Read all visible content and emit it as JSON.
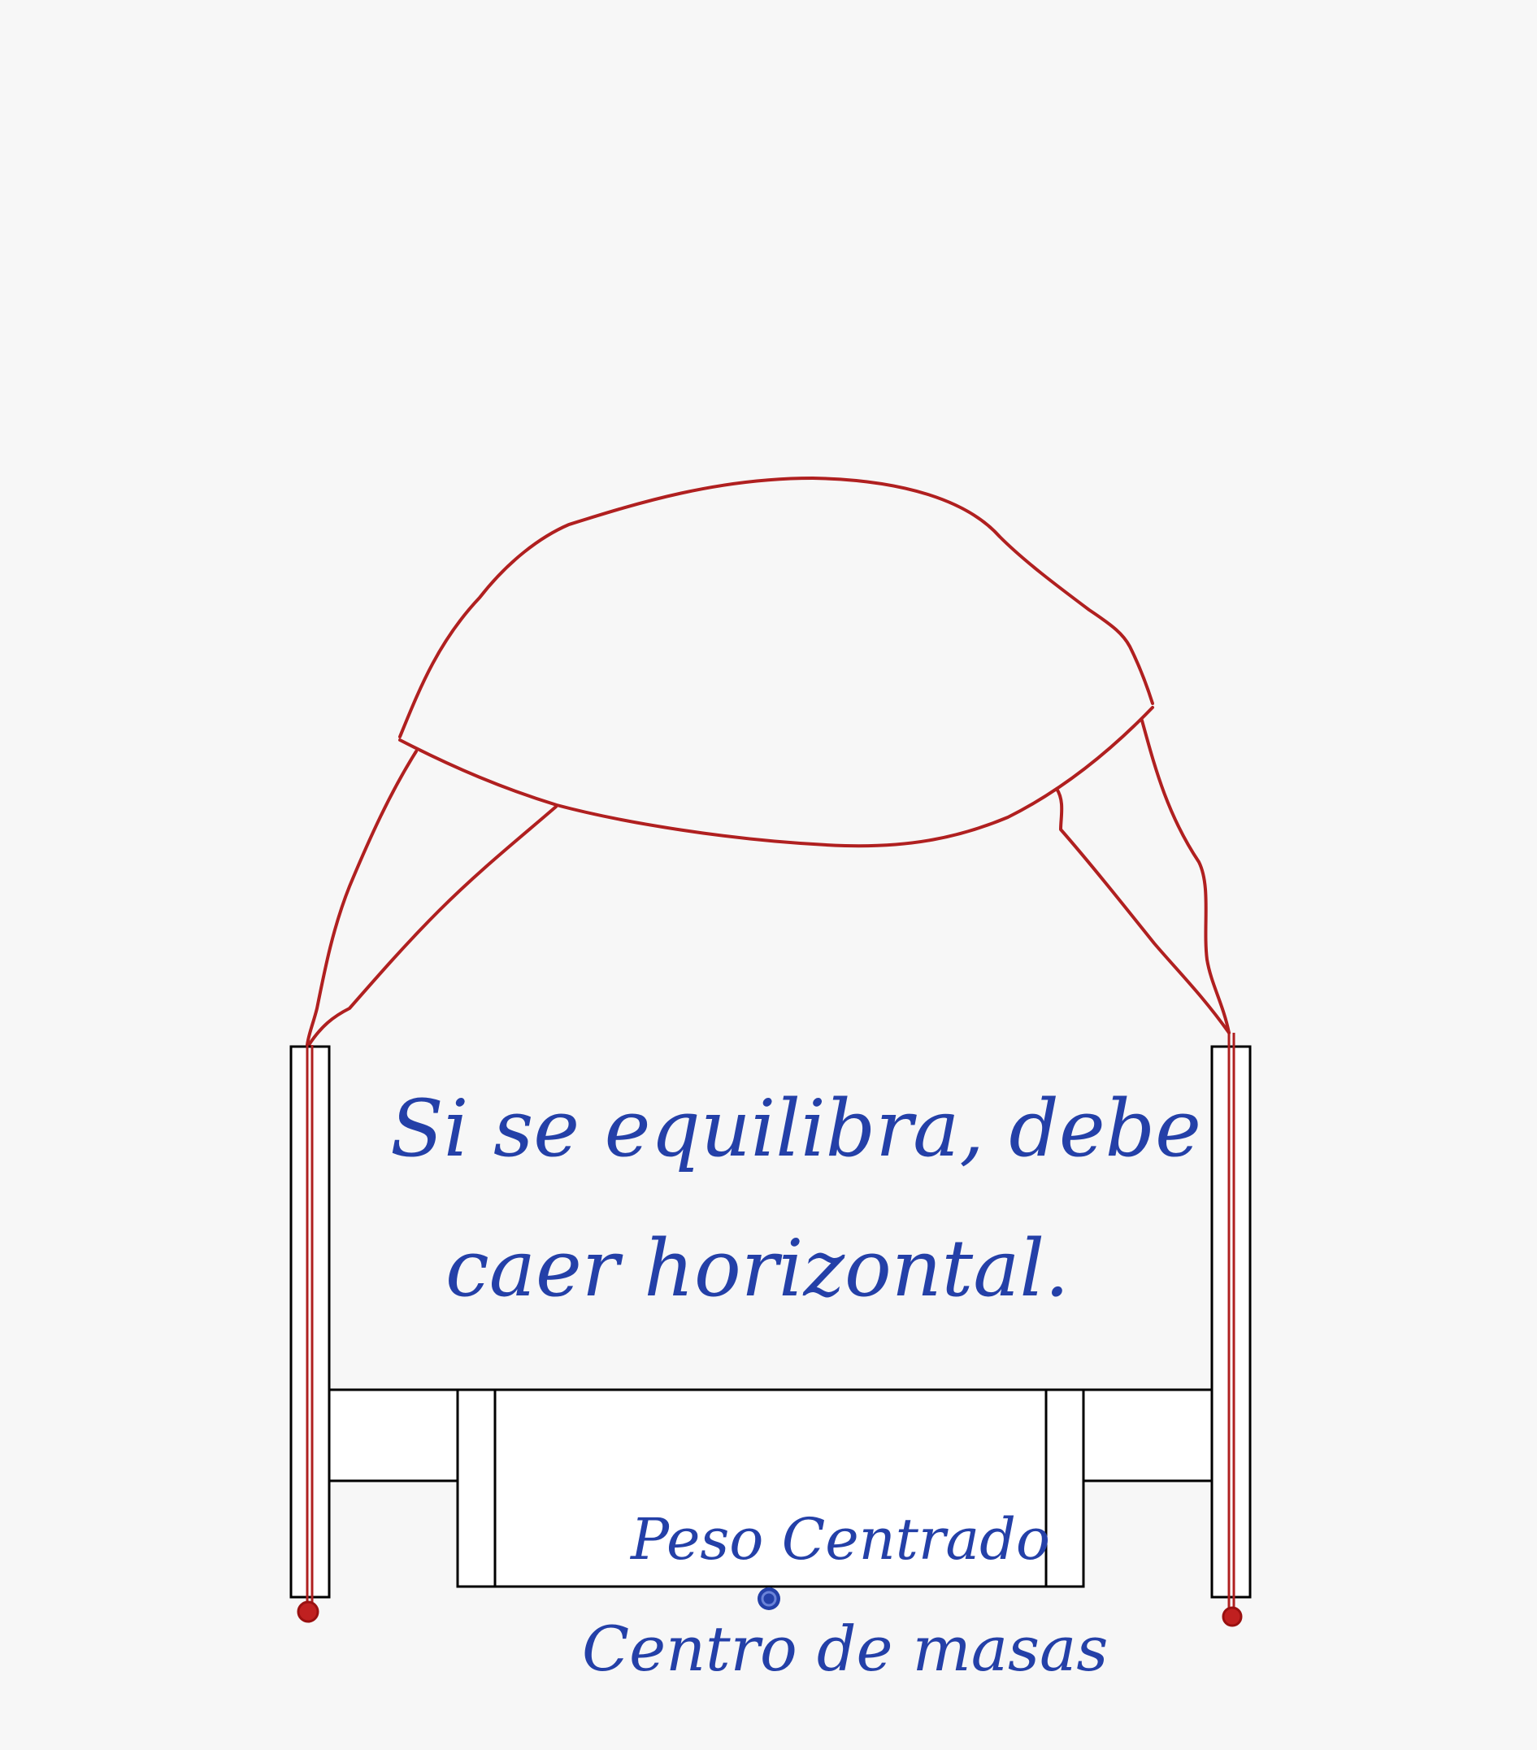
{
  "notes": {
    "line_1": "Si se equilibra, debe",
    "line_2": "caer horizontal.",
    "weight_label": "Peso Centrado",
    "center_label": "Centro de masas"
  },
  "colors": {
    "background": "#f7f7f7",
    "outline": "#000000",
    "rope": "#b02020",
    "ink": "#2440a8"
  }
}
